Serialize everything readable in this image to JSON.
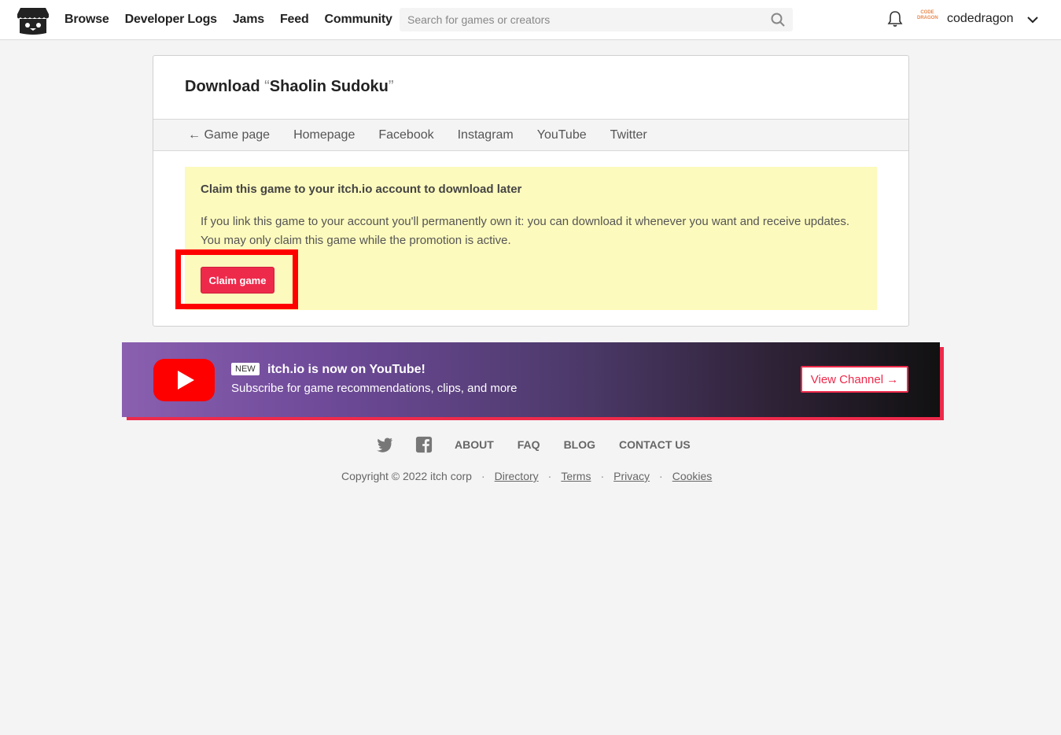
{
  "header": {
    "nav": [
      "Browse",
      "Developer Logs",
      "Jams",
      "Feed",
      "Community"
    ],
    "search_placeholder": "Search for games or creators",
    "username": "codedragon",
    "avatar_text": "CODE DRAGON"
  },
  "card": {
    "title_prefix": "Download ",
    "open_quote": "“",
    "game_name": "Shaolin Sudoku",
    "close_quote": "”",
    "subnav": [
      "← Game page",
      "Homepage",
      "Facebook",
      "Instagram",
      "YouTube",
      "Twitter"
    ],
    "promo": {
      "title": "Claim this game to your itch.io account to download later",
      "text": "If you link this game to your account you'll permanently own it: you can download it whenever you want and receive updates. You may only claim this game while the promotion is active.",
      "button": "Claim game"
    }
  },
  "banner": {
    "badge": "NEW",
    "headline": "itch.io is now on YouTube!",
    "subtitle": "Subscribe for game recommendations, clips, and more",
    "button": "View Channel →"
  },
  "footer": {
    "links": [
      "ABOUT",
      "FAQ",
      "BLOG",
      "CONTACT US"
    ],
    "copyright": "Copyright © 2022 itch corp",
    "legal": [
      "Directory",
      "Terms",
      "Privacy",
      "Cookies"
    ]
  },
  "colors": {
    "accent": "#ee2a4b",
    "promo_bg": "#fcfabd",
    "highlight": "#ff0000"
  }
}
